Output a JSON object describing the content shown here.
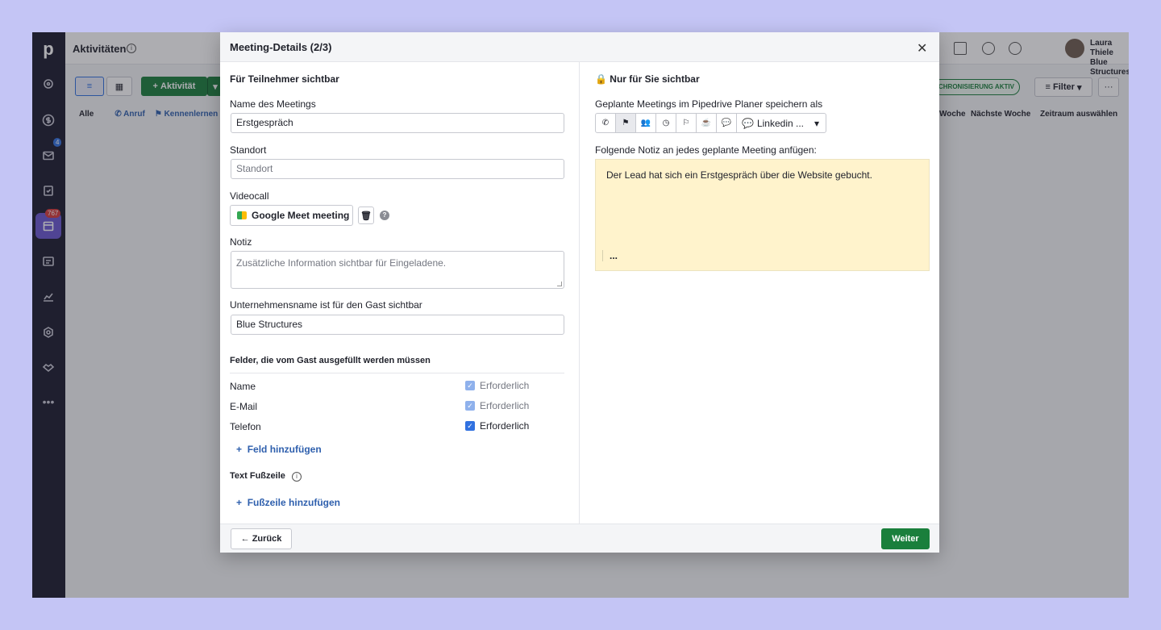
{
  "app": {
    "title": "Aktivitäten",
    "add_activity": "Aktivität",
    "sync_status": "CHRONISIERUNG AKTIV",
    "filter": "Filter",
    "user_name": "Laura Thiele",
    "user_company": "Blue Structures",
    "filters": [
      "Alle",
      "Anruf",
      "Kennenlernen"
    ],
    "right_filters": [
      "Woche",
      "Nächste Woche",
      "Zeitraum auswählen"
    ],
    "badges": {
      "mail": "4",
      "calendar": "767"
    }
  },
  "modal": {
    "title": "Meeting-Details (2/3)",
    "left": {
      "section_title": "Für Teilnehmer sichtbar",
      "meeting_name_label": "Name des Meetings",
      "meeting_name_value": "Erstgespräch",
      "location_label": "Standort",
      "location_placeholder": "Standort",
      "videocall_label": "Videocall",
      "videocall_button": "Google Meet meeting",
      "note_label": "Notiz",
      "note_placeholder": "Zusätzliche Information sichtbar für Eingeladene.",
      "company_label": "Unternehmensname ist für den Gast sichtbar",
      "company_value": "Blue Structures",
      "fields_title": "Felder, die vom Gast ausgefüllt werden müssen",
      "fields": [
        {
          "name": "Name",
          "status": "Erforderlich"
        },
        {
          "name": "E-Mail",
          "status": "Erforderlich"
        },
        {
          "name": "Telefon",
          "status": "Erforderlich"
        }
      ],
      "add_field": "Feld hinzufügen",
      "footer_text_label": "Text Fußzeile",
      "add_footer": "Fußzeile hinzufügen"
    },
    "right": {
      "section_title": "Nur für Sie sichtbar",
      "save_as_label": "Geplante Meetings im Pipedrive Planer speichern als",
      "save_as_selected": "Linkedin ...",
      "note_label": "Folgende Notiz an jedes geplante Meeting anfügen:",
      "note_text": "Der Lead hat sich ein Erstgespräch über die Website gebucht.",
      "more": "..."
    },
    "footer": {
      "back": "Zurück",
      "next": "Weiter"
    }
  }
}
